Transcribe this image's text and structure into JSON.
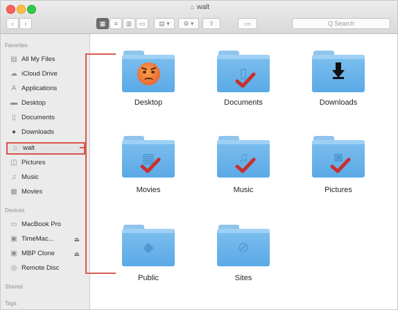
{
  "window": {
    "title": "walt",
    "title_icon": "home-icon"
  },
  "toolbar": {
    "back_glyph": "‹",
    "forward_glyph": "›",
    "view_buttons": [
      "icon-view",
      "list-view",
      "column-view",
      "coverflow-view"
    ],
    "arrange_glyph": "▤ ▾",
    "action_glyph": "⚙ ▾",
    "share_glyph": "⇧",
    "tags_glyph": "▭",
    "search_placeholder": "Q Search"
  },
  "sidebar": {
    "favorites_header": "Favorites",
    "favorites": [
      {
        "label": "All My Files",
        "icon": "all-files-icon"
      },
      {
        "label": "iCloud Drive",
        "icon": "cloud-icon"
      },
      {
        "label": "Applications",
        "icon": "applications-icon"
      },
      {
        "label": "Desktop",
        "icon": "desktop-icon"
      },
      {
        "label": "Documents",
        "icon": "documents-icon"
      },
      {
        "label": "Downloads",
        "icon": "downloads-icon"
      },
      {
        "label": "walt",
        "icon": "home-icon",
        "selected": true
      },
      {
        "label": "Pictures",
        "icon": "pictures-icon"
      },
      {
        "label": "Music",
        "icon": "music-icon"
      },
      {
        "label": "Movies",
        "icon": "movies-icon"
      }
    ],
    "devices_header": "Devices",
    "devices": [
      {
        "label": "MacBook Pro",
        "icon": "laptop-icon"
      },
      {
        "label": "TimeMac...",
        "icon": "disk-icon",
        "eject": "⏏"
      },
      {
        "label": "MBP Clone",
        "icon": "disk-icon",
        "eject": "⏏"
      },
      {
        "label": "Remote Disc",
        "icon": "disc-icon"
      }
    ],
    "shared_header": "Shared",
    "tags_header": "Tags"
  },
  "folders": [
    {
      "label": "Desktop",
      "badge": "angry-emoji"
    },
    {
      "label": "Documents",
      "badge": "checkmark"
    },
    {
      "label": "Downloads",
      "badge": "down-arrow"
    },
    {
      "label": "Movies",
      "badge": "checkmark"
    },
    {
      "label": "Music",
      "badge": "checkmark"
    },
    {
      "label": "Pictures",
      "badge": "checkmark"
    },
    {
      "label": "Public",
      "badge": ""
    },
    {
      "label": "Sites",
      "badge": ""
    }
  ],
  "colors": {
    "annotation_red": "#d95a50",
    "folder_blue": "#5aa9e6",
    "check_red": "#c9302c"
  }
}
